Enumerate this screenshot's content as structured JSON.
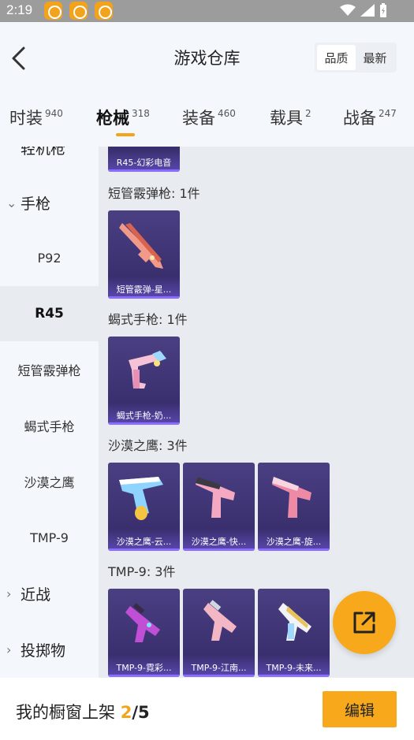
{
  "status_bar": {
    "time": "2:19"
  },
  "header": {
    "title": "游戏仓库",
    "sort_options": [
      "品质",
      "最新"
    ]
  },
  "tabs": [
    {
      "label": "时装",
      "count": "940"
    },
    {
      "label": "枪械",
      "count": "318"
    },
    {
      "label": "装备",
      "count": "460"
    },
    {
      "label": "载具",
      "count": "2"
    },
    {
      "label": "战备",
      "count": "247"
    }
  ],
  "sidebar": {
    "partial_top": "轻机枪",
    "group_pistol": "手枪",
    "items": [
      "P92",
      "R45",
      "短管霰弹枪",
      "蝎式手枪",
      "沙漠之鹰",
      "TMP-9"
    ],
    "group_melee": "近战",
    "group_throw": "投掷物"
  },
  "content": {
    "top_card_label": "R45-幻彩电音",
    "sections": [
      {
        "title": "短管霰弹枪: 1件",
        "items": [
          "短管霰弹-星..."
        ]
      },
      {
        "title": "蝎式手枪: 1件",
        "items": [
          "蝎式手枪-奶..."
        ]
      },
      {
        "title": "沙漠之鹰: 3件",
        "items": [
          "沙漠之鹰-云...",
          "沙漠之鹰-快...",
          "沙漠之鹰-旋..."
        ]
      },
      {
        "title": "TMP-9: 3件",
        "items": [
          "TMP-9-霓彩...",
          "TMP-9-江南...",
          "TMP-9-未来..."
        ]
      }
    ]
  },
  "footer": {
    "label": "我的橱窗上架",
    "count": "2",
    "total": "/5",
    "edit_label": "编辑"
  },
  "colors": {
    "accent": "#f7a81b",
    "card_bg": "#3a2f6e"
  }
}
